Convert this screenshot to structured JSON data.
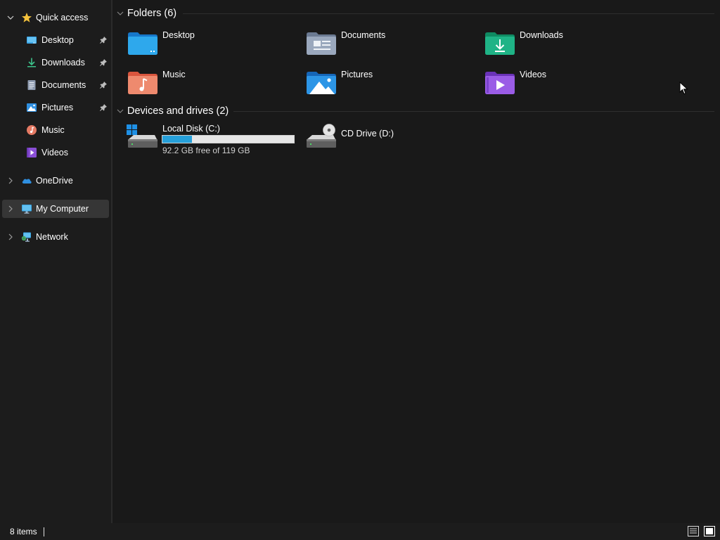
{
  "sidebar": {
    "items": [
      {
        "label": "Quick access",
        "icon": "star-icon",
        "expanded": true
      },
      {
        "label": "Desktop",
        "icon": "desktop-icon",
        "pinned": true
      },
      {
        "label": "Downloads",
        "icon": "download-icon",
        "pinned": true
      },
      {
        "label": "Documents",
        "icon": "document-icon",
        "pinned": true
      },
      {
        "label": "Pictures",
        "icon": "pictures-icon",
        "pinned": true
      },
      {
        "label": "Music",
        "icon": "music-icon"
      },
      {
        "label": "Videos",
        "icon": "videos-icon"
      },
      {
        "label": "OneDrive",
        "icon": "onedrive-cloud-icon",
        "expanded": false
      },
      {
        "label": "My Computer",
        "icon": "computer-icon",
        "expanded": false,
        "selected": true
      },
      {
        "label": "Network",
        "icon": "network-icon",
        "expanded": false
      }
    ]
  },
  "content": {
    "folders_header": "Folders (6)",
    "folders": [
      {
        "name": "Desktop",
        "icon": "desktop-folder-icon",
        "color": "#1e90e6"
      },
      {
        "name": "Documents",
        "icon": "documents-folder-icon",
        "color": "#8a9bb5"
      },
      {
        "name": "Downloads",
        "icon": "downloads-folder-icon",
        "color": "#1aa67a"
      },
      {
        "name": "Music",
        "icon": "music-folder-icon",
        "color": "#e8735a"
      },
      {
        "name": "Pictures",
        "icon": "pictures-folder-icon",
        "color": "#2a8de0"
      },
      {
        "name": "Videos",
        "icon": "videos-folder-icon",
        "color": "#8a4fd6"
      }
    ],
    "drives_header": "Devices and drives (2)",
    "drives": [
      {
        "name": "Local Disk (C:)",
        "icon": "local-disk-icon",
        "free_text": "92.2 GB free of 119 GB",
        "used_fraction": 0.225
      },
      {
        "name": "CD Drive (D:)",
        "icon": "cd-drive-icon"
      }
    ]
  },
  "statusbar": {
    "item_count": "8 items",
    "views": [
      "details-view-icon",
      "large-icons-view-icon"
    ]
  },
  "colors": {
    "background": "#191919",
    "sidebar": "#1c1c1c",
    "selection": "#363636",
    "accent": "#26a0da"
  }
}
